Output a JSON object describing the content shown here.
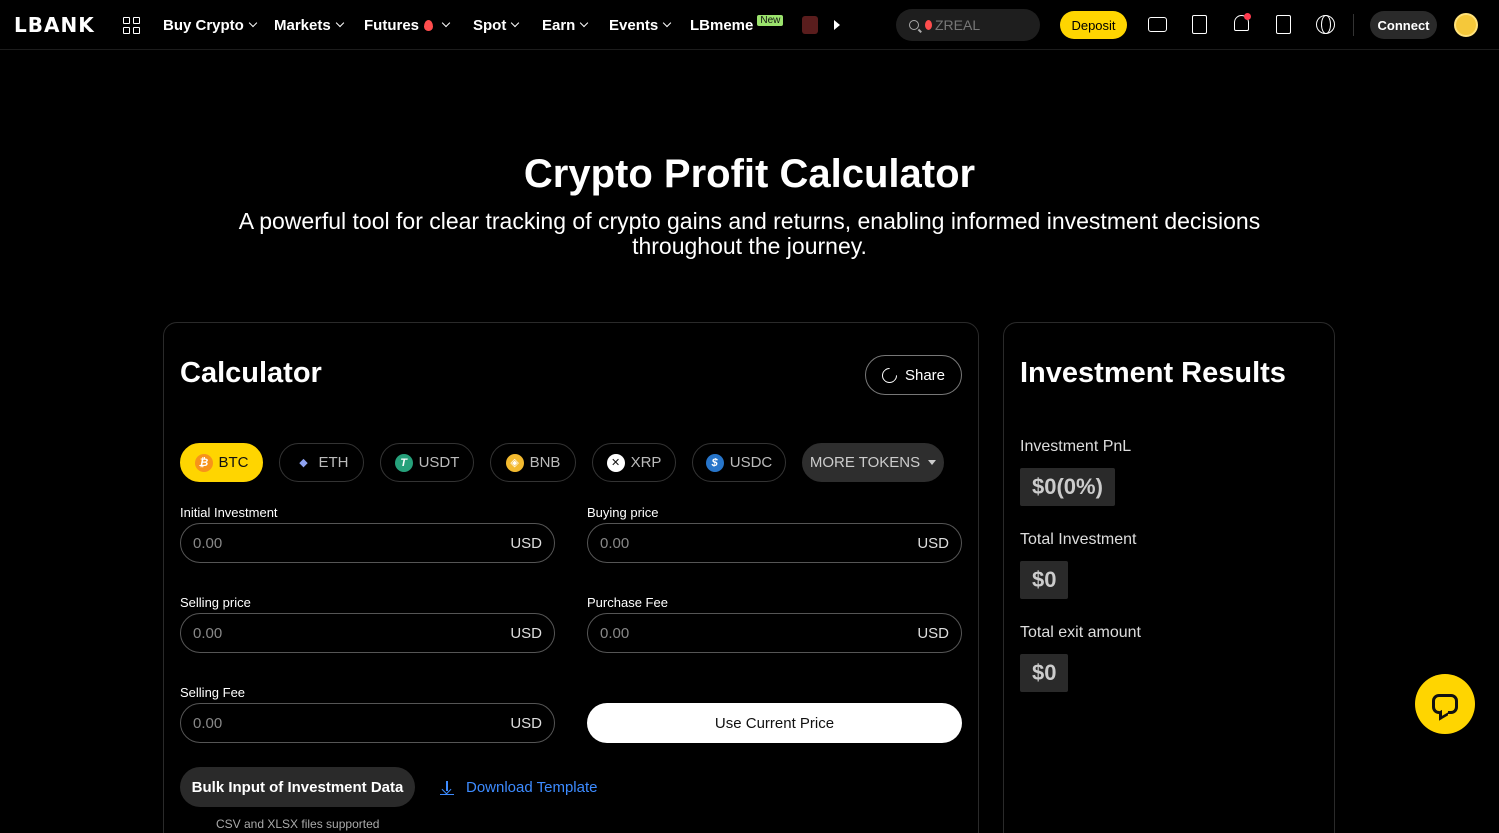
{
  "header": {
    "logo": "LBANK",
    "nav": [
      {
        "label": "Buy Crypto"
      },
      {
        "label": "Markets"
      },
      {
        "label": "Futures"
      },
      {
        "label": "Spot"
      },
      {
        "label": "Earn"
      },
      {
        "label": "Events"
      },
      {
        "label": "LBmeme",
        "badge": "New"
      }
    ],
    "search_placeholder": "ZREAL",
    "deposit_label": "Deposit",
    "connect_label": "Connect",
    "icons": [
      "grid-icon",
      "fire-icon",
      "search-icon",
      "wallet-icon",
      "orders-icon",
      "bell-icon",
      "download-app-icon",
      "globe-icon"
    ]
  },
  "hero": {
    "title": "Crypto Profit Calculator",
    "subtitle": "A powerful tool for clear tracking of crypto gains and returns, enabling informed investment decisions throughout the journey."
  },
  "calculator": {
    "title": "Calculator",
    "share_label": "Share",
    "tokens": [
      {
        "symbol": "BTC",
        "glyph": "₿",
        "color": "#f7931a",
        "active": true
      },
      {
        "symbol": "ETH",
        "glyph": "◆",
        "color": "#627eea",
        "active": false
      },
      {
        "symbol": "USDT",
        "glyph": "T",
        "color": "#26a17b",
        "active": false
      },
      {
        "symbol": "BNB",
        "glyph": "◈",
        "color": "#f3ba2f",
        "active": false
      },
      {
        "symbol": "XRP",
        "glyph": "✕",
        "color": "#23292f",
        "active": false
      },
      {
        "symbol": "USDC",
        "glyph": "$",
        "color": "#2775ca",
        "active": false
      }
    ],
    "more_tokens_label": "MORE TOKENS",
    "fields": {
      "initial_investment": {
        "label": "Initial Investment",
        "value": "0.00",
        "unit": "USD"
      },
      "buying_price": {
        "label": "Buying price",
        "value": "0.00",
        "unit": "USD"
      },
      "selling_price": {
        "label": "Selling price",
        "value": "0.00",
        "unit": "USD"
      },
      "purchase_fee": {
        "label": "Purchase Fee",
        "value": "0.00",
        "unit": "USD"
      },
      "selling_fee": {
        "label": "Selling Fee",
        "value": "0.00",
        "unit": "USD"
      }
    },
    "use_current_price_label": "Use Current Price",
    "bulk_input_label": "Bulk Input of Investment Data",
    "download_template_label": "Download Template",
    "files_hint": "CSV and XLSX files supported"
  },
  "results": {
    "title": "Investment Results",
    "items": [
      {
        "label": "Investment PnL",
        "value": "$0(0%)"
      },
      {
        "label": "Total Investment",
        "value": "$0"
      },
      {
        "label": "Total exit amount",
        "value": "$0"
      }
    ]
  },
  "colors": {
    "accent": "#ffd500",
    "link": "#3d8bff",
    "background": "#000000"
  }
}
